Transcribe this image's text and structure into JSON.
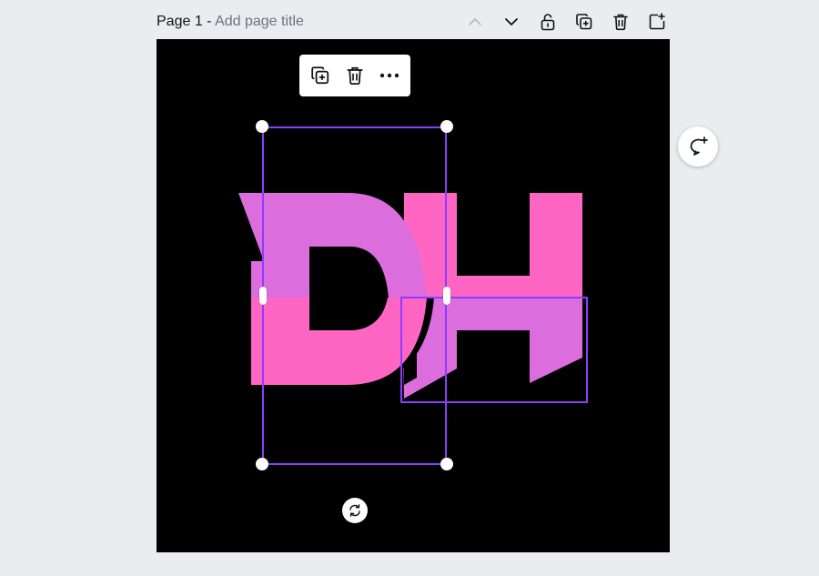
{
  "header": {
    "page_label": "Page 1",
    "separator": " - ",
    "title_placeholder": "Add page title"
  },
  "header_icons": [
    "chevron-up-icon",
    "chevron-down-icon",
    "unlock-icon",
    "duplicate-page-icon",
    "delete-page-icon",
    "add-page-icon"
  ],
  "toolbar_icons": [
    "duplicate-icon",
    "trash-icon",
    "more-icon"
  ],
  "colors": {
    "background": "#ebecf0",
    "canvas": "#000000",
    "selection": "#8b3dff",
    "pink": "#ff66c4",
    "violet": "#db6ddc"
  },
  "design": {
    "letters": [
      "D",
      "H"
    ]
  }
}
